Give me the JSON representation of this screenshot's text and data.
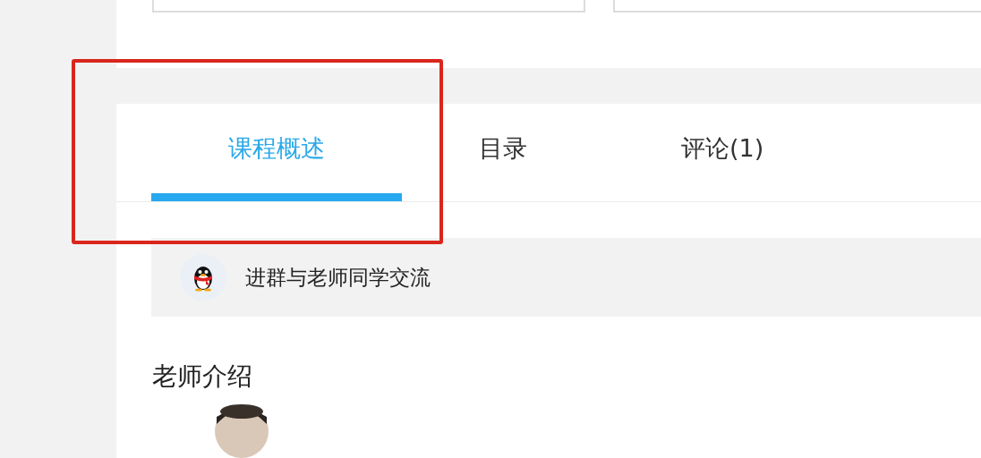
{
  "tabs": [
    {
      "label": "课程概述",
      "selected": true
    },
    {
      "label": "目录",
      "selected": false
    },
    {
      "label": "评论(1)",
      "selected": false
    }
  ],
  "group_banner": {
    "text": "进群与老师同学交流"
  },
  "teacher_section": {
    "title": "老师介绍"
  }
}
